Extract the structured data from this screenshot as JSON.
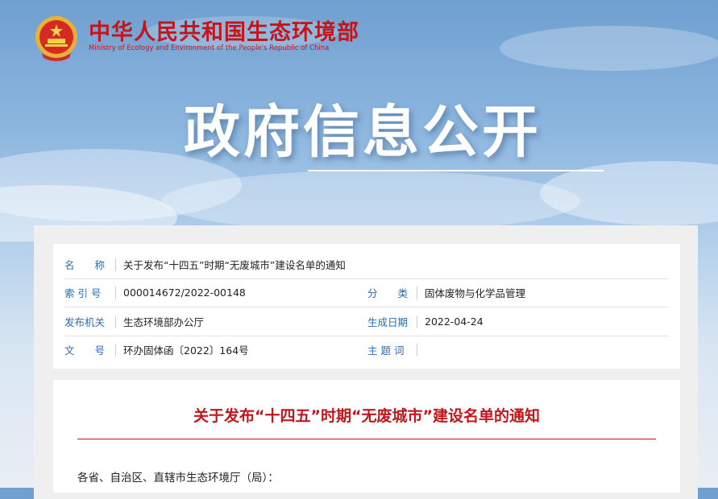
{
  "header": {
    "org_name_cn": "中华人民共和国生态环境部",
    "org_name_en": "Ministry of Ecology and Environment of the People's Republic of China",
    "emblem_icon": "national-emblem-icon"
  },
  "banner": {
    "title": "政府信息公开"
  },
  "meta": {
    "name_label": "名　　称",
    "name_value": "关于发布“十四五”时期“无废城市”建设名单的通知",
    "index_label": "索 引 号",
    "index_value": "000014672/2022-00148",
    "category_label": "分　　类",
    "category_value": "固体废物与化学品管理",
    "issuer_label": "发布机关",
    "issuer_value": "生态环境部办公厅",
    "date_label": "生成日期",
    "date_value": "2022-04-24",
    "doc_no_label": "文　　号",
    "doc_no_value": "环办固体函〔2022〕164号",
    "keywords_label": "主 题 词",
    "keywords_value": ""
  },
  "document": {
    "title": "关于发布“十四五”时期“无废城市”建设名单的通知",
    "salutation": "各省、自治区、直辖市生态环境厅（局）："
  },
  "colors": {
    "brand_red": "#c3161c",
    "label_blue": "#2b6cb4"
  }
}
